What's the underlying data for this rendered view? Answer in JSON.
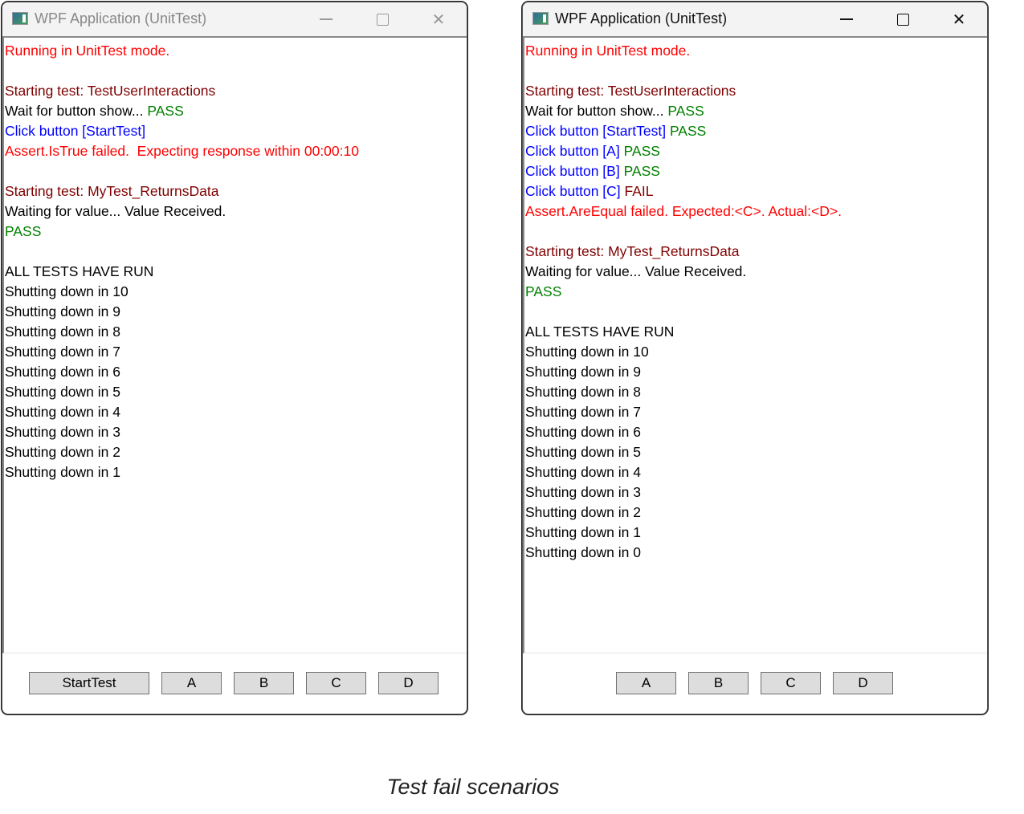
{
  "colors": {
    "red": "#ff0000",
    "darkred": "#800000",
    "black": "#000000",
    "green": "#008000",
    "blue": "#0000ff"
  },
  "windows": [
    {
      "title": "WPF Application (UnitTest)",
      "active": false,
      "lines": [
        [
          {
            "t": "Running in UnitTest mode.",
            "c": "red"
          }
        ],
        [],
        [
          {
            "t": "Starting test: TestUserInteractions",
            "c": "darkred"
          }
        ],
        [
          {
            "t": "Wait for button show... ",
            "c": "black"
          },
          {
            "t": "PASS",
            "c": "green"
          }
        ],
        [
          {
            "t": "Click button [StartTest]",
            "c": "blue"
          }
        ],
        [
          {
            "t": "Assert.IsTrue failed.  Expecting response within 00:00:10",
            "c": "red"
          }
        ],
        [],
        [
          {
            "t": "Starting test: MyTest_ReturnsData",
            "c": "darkred"
          }
        ],
        [
          {
            "t": "Waiting for value... Value Received.",
            "c": "black"
          }
        ],
        [
          {
            "t": "PASS",
            "c": "green"
          }
        ],
        [],
        [
          {
            "t": "ALL TESTS HAVE RUN",
            "c": "black"
          }
        ],
        [
          {
            "t": "Shutting down in 10",
            "c": "black"
          }
        ],
        [
          {
            "t": "Shutting down in 9",
            "c": "black"
          }
        ],
        [
          {
            "t": "Shutting down in 8",
            "c": "black"
          }
        ],
        [
          {
            "t": "Shutting down in 7",
            "c": "black"
          }
        ],
        [
          {
            "t": "Shutting down in 6",
            "c": "black"
          }
        ],
        [
          {
            "t": "Shutting down in 5",
            "c": "black"
          }
        ],
        [
          {
            "t": "Shutting down in 4",
            "c": "black"
          }
        ],
        [
          {
            "t": "Shutting down in 3",
            "c": "black"
          }
        ],
        [
          {
            "t": "Shutting down in 2",
            "c": "black"
          }
        ],
        [
          {
            "t": "Shutting down in 1",
            "c": "black"
          }
        ]
      ],
      "buttons": [
        "StartTest",
        "A",
        "B",
        "C",
        "D"
      ]
    },
    {
      "title": "WPF Application (UnitTest)",
      "active": true,
      "lines": [
        [
          {
            "t": "Running in UnitTest mode.",
            "c": "red"
          }
        ],
        [],
        [
          {
            "t": "Starting test: TestUserInteractions",
            "c": "darkred"
          }
        ],
        [
          {
            "t": "Wait for button show... ",
            "c": "black"
          },
          {
            "t": "PASS",
            "c": "green"
          }
        ],
        [
          {
            "t": "Click button [StartTest] ",
            "c": "blue"
          },
          {
            "t": "PASS",
            "c": "green"
          }
        ],
        [
          {
            "t": "Click button [A] ",
            "c": "blue"
          },
          {
            "t": "PASS",
            "c": "green"
          }
        ],
        [
          {
            "t": "Click button [B] ",
            "c": "blue"
          },
          {
            "t": "PASS",
            "c": "green"
          }
        ],
        [
          {
            "t": "Click button [C] ",
            "c": "blue"
          },
          {
            "t": "FAIL",
            "c": "darkred"
          }
        ],
        [
          {
            "t": "Assert.AreEqual failed. Expected:<C>. Actual:<D>.",
            "c": "red"
          }
        ],
        [],
        [
          {
            "t": "Starting test: MyTest_ReturnsData",
            "c": "darkred"
          }
        ],
        [
          {
            "t": "Waiting for value... Value Received.",
            "c": "black"
          }
        ],
        [
          {
            "t": "PASS",
            "c": "green"
          }
        ],
        [],
        [
          {
            "t": "ALL TESTS HAVE RUN",
            "c": "black"
          }
        ],
        [
          {
            "t": "Shutting down in 10",
            "c": "black"
          }
        ],
        [
          {
            "t": "Shutting down in 9",
            "c": "black"
          }
        ],
        [
          {
            "t": "Shutting down in 8",
            "c": "black"
          }
        ],
        [
          {
            "t": "Shutting down in 7",
            "c": "black"
          }
        ],
        [
          {
            "t": "Shutting down in 6",
            "c": "black"
          }
        ],
        [
          {
            "t": "Shutting down in 5",
            "c": "black"
          }
        ],
        [
          {
            "t": "Shutting down in 4",
            "c": "black"
          }
        ],
        [
          {
            "t": "Shutting down in 3",
            "c": "black"
          }
        ],
        [
          {
            "t": "Shutting down in 2",
            "c": "black"
          }
        ],
        [
          {
            "t": "Shutting down in 1",
            "c": "black"
          }
        ],
        [
          {
            "t": "Shutting down in 0",
            "c": "black"
          }
        ]
      ],
      "buttons": [
        "A",
        "B",
        "C",
        "D"
      ]
    }
  ],
  "caption": "Test fail scenarios"
}
